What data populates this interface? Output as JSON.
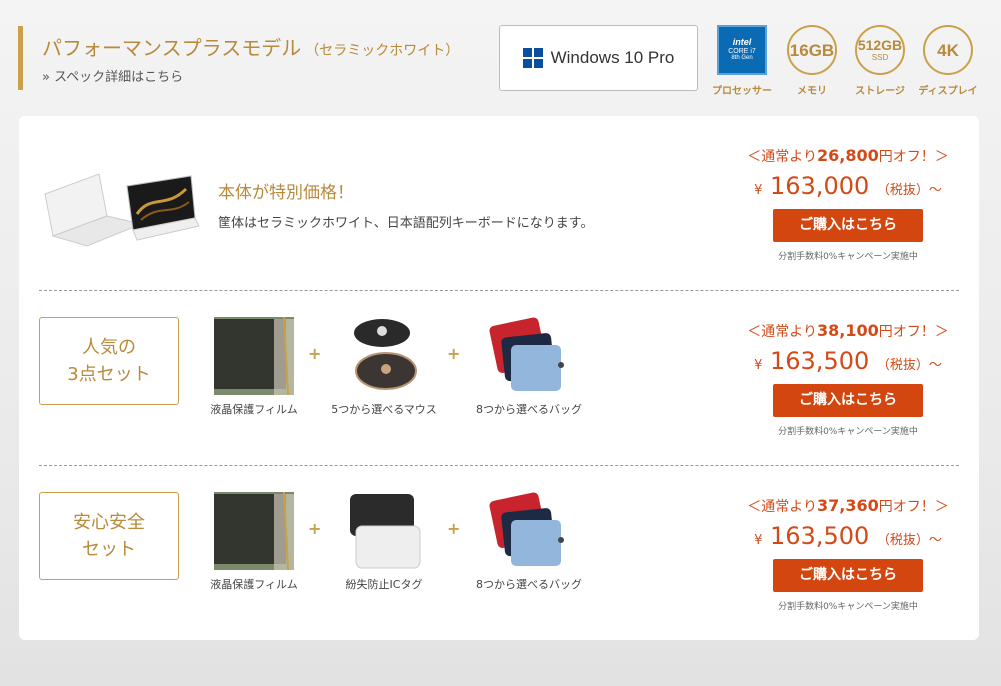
{
  "header": {
    "title": "パフォーマンスプラスモデル",
    "subtitle": "（セラミックホワイト）",
    "spec_link": "» スペック詳細はこちら",
    "os": "Windows 10 Pro"
  },
  "specs": [
    {
      "icon": "intel-core-i7-icon",
      "line1": "intel",
      "line2": "CORE i7",
      "line3": "8th Gen",
      "label": "プロセッサー"
    },
    {
      "icon": "memory-icon",
      "big": "16GB",
      "small": "",
      "label": "メモリ"
    },
    {
      "icon": "storage-icon",
      "big": "512GB",
      "small": "SSD",
      "label": "ストレージ"
    },
    {
      "icon": "display-icon",
      "big": "4K",
      "small": "",
      "label": "ディスプレイ"
    }
  ],
  "rows": [
    {
      "title": "本体が特別価格！",
      "desc": "筐体はセラミックホワイト、日本語配列キーボードになります。",
      "off_prefix": "＜通常より",
      "off_amount": "26,800",
      "off_suffix": "円オフ！＞",
      "yen": "¥",
      "price": "163,000",
      "tax": "（税抜）～",
      "button": "ご購入はこちら",
      "note": "分割手数料0%キャンペーン実施中"
    },
    {
      "set_line1": "人気の",
      "set_line2": "3点セット",
      "items": [
        "液晶保護フィルム",
        "5つから選べるマウス",
        "8つから選べるバッグ"
      ],
      "off_prefix": "＜通常より",
      "off_amount": "38,100",
      "off_suffix": "円オフ！＞",
      "yen": "¥",
      "price": "163,500",
      "tax": "（税抜）～",
      "button": "ご購入はこちら",
      "note": "分割手数料0%キャンペーン実施中"
    },
    {
      "set_line1": "安心安全",
      "set_line2": "セット",
      "items": [
        "液晶保護フィルム",
        "紛失防止ICタグ",
        "8つから選べるバッグ"
      ],
      "off_prefix": "＜通常より",
      "off_amount": "37,360",
      "off_suffix": "円オフ！＞",
      "yen": "¥",
      "price": "163,500",
      "tax": "（税抜）～",
      "button": "ご購入はこちら",
      "note": "分割手数料0%キャンペーン実施中"
    }
  ],
  "plus": "+",
  "colors": {
    "accent": "#c9a14a",
    "price": "#d34a18",
    "button": "#d3460f"
  }
}
